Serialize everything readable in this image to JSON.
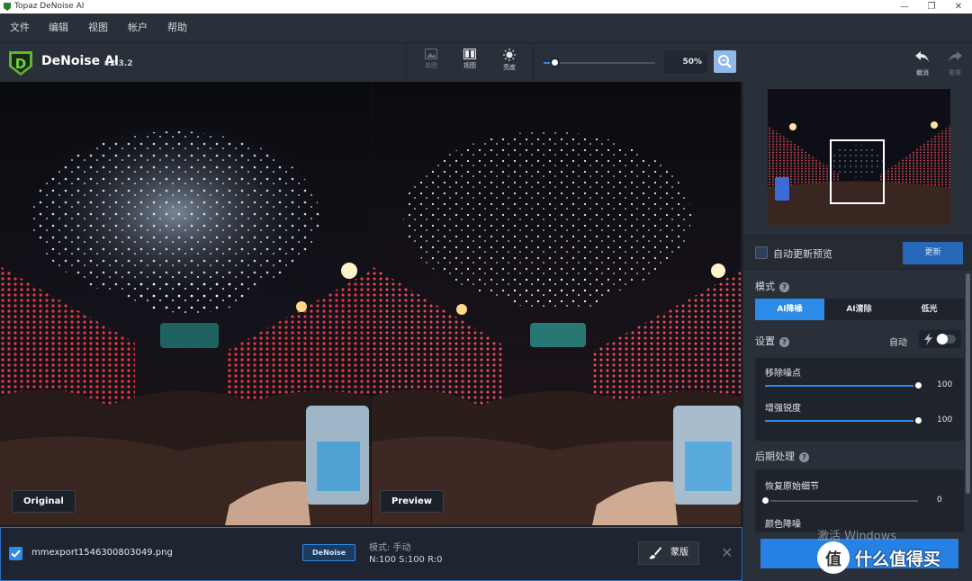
{
  "window": {
    "title": "Topaz DeNoise AI",
    "minimize": "—",
    "maximize": "❐",
    "close": "✕"
  },
  "menu": [
    "文件",
    "编辑",
    "视图",
    "帐户",
    "帮助"
  ],
  "brand": {
    "name": "DeNoise AI",
    "version": "v2.3.2",
    "logo_letter": "D"
  },
  "toolbar": {
    "tools": [
      {
        "label": "单图",
        "icon": "single-image-icon",
        "enabled": false
      },
      {
        "label": "视图",
        "icon": "split-view-icon",
        "enabled": true
      },
      {
        "label": "亮度",
        "icon": "brightness-icon",
        "enabled": true
      }
    ],
    "zoom": {
      "value": "50%",
      "fraction": 0.1
    },
    "undo": "撤消",
    "redo": "重做"
  },
  "viewer": {
    "left_label": "Original",
    "right_label": "Preview"
  },
  "file_bar": {
    "checked": true,
    "filename": "mmexport1546300803049.png",
    "tag": "DeNoise",
    "mode": "模式: 手动",
    "values": "N:100  S:100  R:0",
    "mask_label": "蒙版",
    "close": "✕"
  },
  "sidebar": {
    "auto_update_label": "自动更新预览",
    "update_button": "更新",
    "mode_title": "模式",
    "modes": [
      {
        "label": "AI降噪",
        "active": true
      },
      {
        "label": "AI清除",
        "active": false
      },
      {
        "label": "低光",
        "active": false
      }
    ],
    "settings_title": "设置",
    "auto_label": "自动",
    "sliders": [
      {
        "label": "移除噪点",
        "value": "100",
        "fraction": 1.0
      },
      {
        "label": "增强锐度",
        "value": "100",
        "fraction": 1.0
      }
    ],
    "post_title": "后期处理",
    "post_sliders": [
      {
        "label": "恢复原始细节",
        "value": "0",
        "fraction": 0.0
      }
    ],
    "post_next_label": "颜色降噪",
    "help_glyph": "?"
  },
  "os_watermark": "激活 Windows",
  "site_watermark": {
    "glyph": "值",
    "text": "什么值得买"
  },
  "colors": {
    "accent": "#2c8be8",
    "panel": "#2a3039",
    "dark": "#1f242c"
  }
}
